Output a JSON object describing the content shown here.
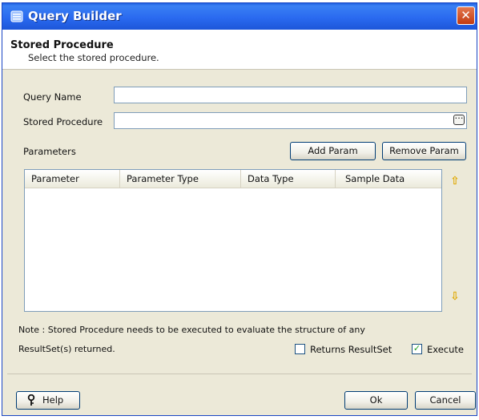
{
  "window": {
    "title": "Query Builder",
    "close_label": "✕",
    "accent_color": "#2a6af0",
    "close_color": "#c23b12"
  },
  "header": {
    "title": "Stored Procedure",
    "subtitle": "Select the stored procedure."
  },
  "form": {
    "query_name_label": "Query Name",
    "query_name_value": "",
    "stored_procedure_label": "Stored Procedure",
    "stored_procedure_value": "",
    "browse_label": "…"
  },
  "parameters": {
    "label": "Parameters",
    "add_label": "Add Param",
    "remove_label": "Remove Param",
    "columns": [
      "Parameter",
      "Parameter Type",
      "Data Type",
      "Sample Data"
    ],
    "rows": []
  },
  "note": {
    "line1": "Note : Stored Procedure needs to be executed to evaluate the structure of any",
    "line2": "ResultSet(s) returned."
  },
  "options": {
    "returns_resultset_label": "Returns ResultSet",
    "returns_resultset_checked": false,
    "execute_label": "Execute",
    "execute_checked": true
  },
  "footer": {
    "help_label": "Help",
    "ok_label": "Ok",
    "cancel_label": "Cancel"
  }
}
